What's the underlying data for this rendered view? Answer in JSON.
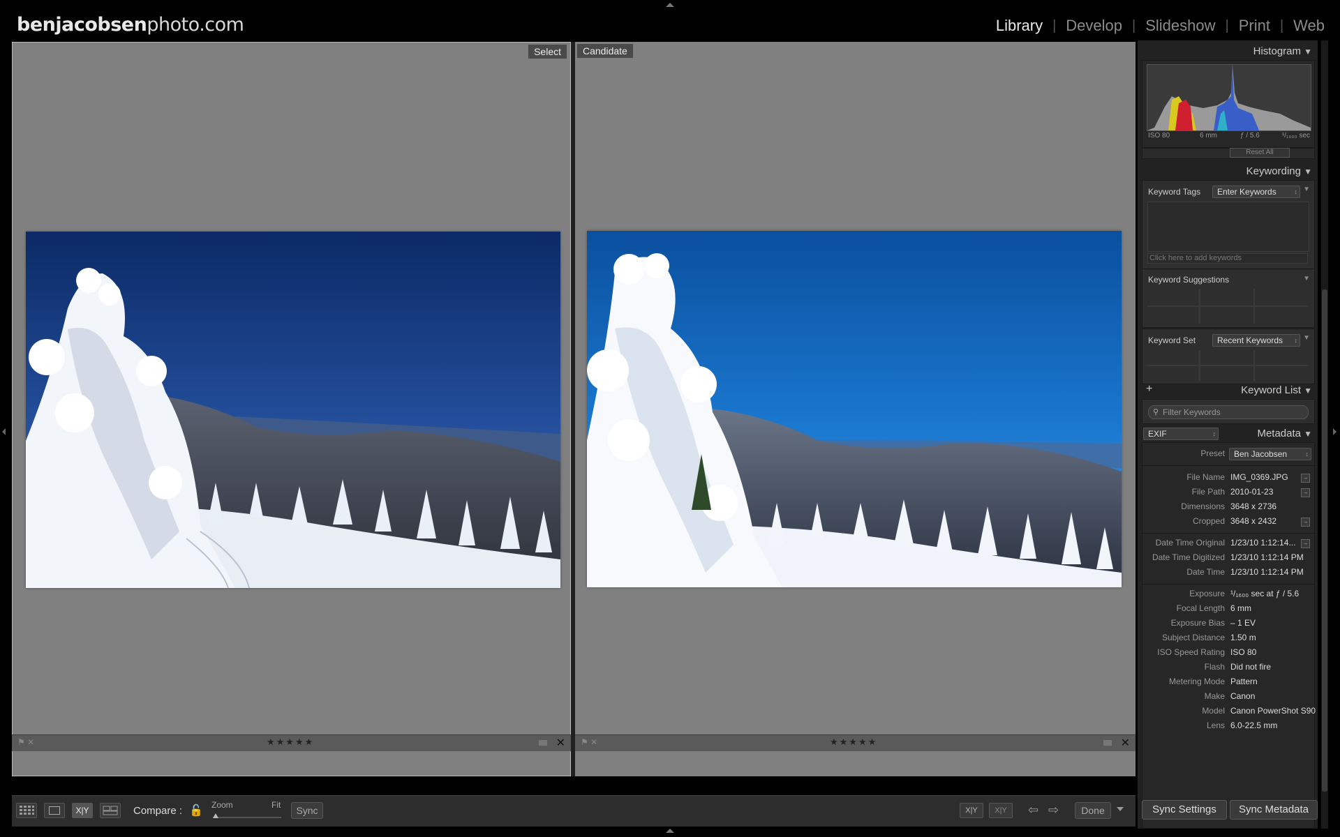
{
  "header": {
    "logo_bold": "benjacobsen",
    "logo_thin": "photo.com",
    "modules": [
      "Library",
      "Develop",
      "Slideshow",
      "Print",
      "Web"
    ],
    "active_module": "Library"
  },
  "compare": {
    "left_label": "Select",
    "right_label": "Candidate",
    "stars": "★★★★★"
  },
  "toolbar": {
    "compare_label": "Compare :",
    "zoom_label": "Zoom",
    "fit_label": "Fit",
    "sync_label": "Sync",
    "done_label": "Done",
    "view_xy_label": "X|Y",
    "swap_label": "X|Y"
  },
  "histogram": {
    "title": "Histogram",
    "iso": "ISO 80",
    "focal": "6 mm",
    "aperture": "ƒ / 5.6",
    "shutter": "¹/₁₆₀₀ sec",
    "reset": "Reset All"
  },
  "keywording": {
    "title": "Keywording",
    "tags_label": "Keyword Tags",
    "tags_dropdown": "Enter Keywords",
    "add_placeholder": "Click here to add keywords",
    "suggestions_label": "Keyword Suggestions",
    "set_label": "Keyword Set",
    "set_dropdown": "Recent Keywords"
  },
  "keyword_list": {
    "title": "Keyword List",
    "plus": "+",
    "filter_placeholder": "Filter Keywords"
  },
  "metadata": {
    "title": "Metadata",
    "mode": "EXIF",
    "preset_label": "Preset",
    "preset_value": "Ben Jacobsen",
    "rows": [
      {
        "k": "File Name",
        "v": "IMG_0369.JPG"
      },
      {
        "k": "File Path",
        "v": "2010-01-23"
      },
      {
        "k": "Dimensions",
        "v": "3648 x 2736"
      },
      {
        "k": "Cropped",
        "v": "3648 x 2432"
      },
      {
        "k": "Date Time Original",
        "v": "1/23/10 1:12:14..."
      },
      {
        "k": "Date Time Digitized",
        "v": "1/23/10 1:12:14 PM"
      },
      {
        "k": "Date Time",
        "v": "1/23/10 1:12:14 PM"
      },
      {
        "k": "Exposure",
        "v": "¹/₁₆₀₀ sec at ƒ / 5.6"
      },
      {
        "k": "Focal Length",
        "v": "6 mm"
      },
      {
        "k": "Exposure Bias",
        "v": "– 1 EV"
      },
      {
        "k": "Subject Distance",
        "v": "1.50 m"
      },
      {
        "k": "ISO Speed Rating",
        "v": "ISO 80"
      },
      {
        "k": "Flash",
        "v": "Did not fire"
      },
      {
        "k": "Metering Mode",
        "v": "Pattern"
      },
      {
        "k": "Make",
        "v": "Canon"
      },
      {
        "k": "Model",
        "v": "Canon PowerShot S90"
      },
      {
        "k": "Lens",
        "v": "6.0-22.5 mm"
      }
    ]
  },
  "buttons": {
    "sync_settings": "Sync Settings",
    "sync_metadata": "Sync Metadata"
  }
}
